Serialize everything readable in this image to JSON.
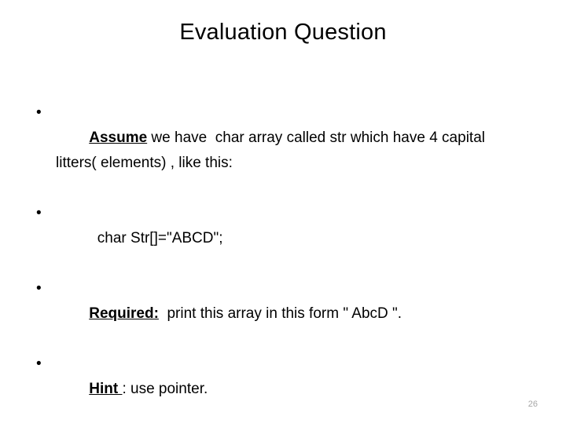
{
  "slide": {
    "title": "Evaluation Question",
    "page_number": "26",
    "background_color": "#ffffff",
    "text_color": "#000000",
    "page_number_color": "#a6a6a6",
    "bullet_glyph": "•",
    "bullets": [
      {
        "keyword": "Assume",
        "rest": " we have  char array called str which have 4 capital litters( elements) , like this:",
        "full_text": "Assume we have  char array called str which have 4 capital litters( elements) , like this:"
      },
      {
        "keyword": "",
        "rest": "  char Str[]=\"ABCD\";",
        "full_text": " char Str[]=\"ABCD\";"
      },
      {
        "keyword": "Required:",
        "rest": "  print this array in this form \" AbcD \".",
        "full_text": "Required:  print this array in this form \" AbcD \"."
      },
      {
        "keyword": "Hint ",
        "rest": ": use pointer.",
        "full_text": "Hint : use pointer."
      }
    ]
  }
}
